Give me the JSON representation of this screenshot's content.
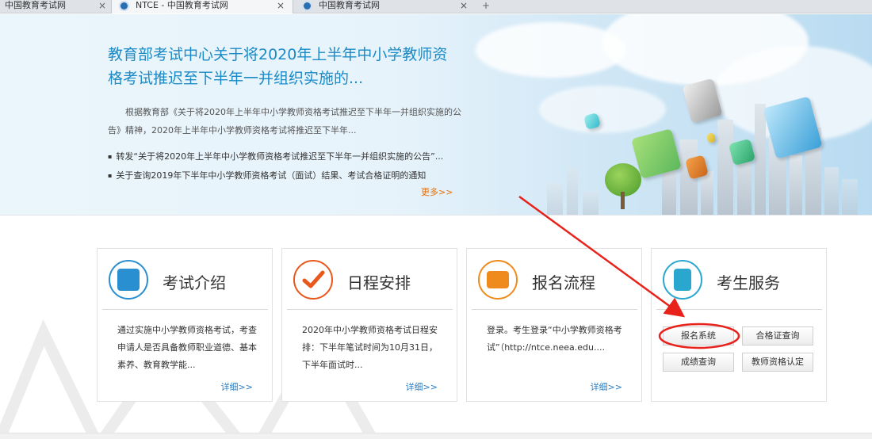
{
  "browser": {
    "tabs": [
      {
        "label": "中国教育考试网"
      },
      {
        "label": "NTCE - 中国教育考试网"
      },
      {
        "label": "中国教育考试网"
      }
    ]
  },
  "banner": {
    "title": "教育部考试中心关于将2020年上半年中小学教师资格考试推迟至下半年一并组织实施的...",
    "body": "根据教育部《关于将2020年上半年中小学教师资格考试推迟至下半年一并组织实施的公告》精神，2020年上半年中小学教师资格考试将推迟至下半年...",
    "list": [
      "转发“关于将2020年上半年中小学教师资格考试推迟至下半年一并组织实施的公告”...",
      "关于查询2019年下半年中小学教师资格考试（面试）结果、考试合格证明的通知"
    ],
    "more": "更多>>"
  },
  "cards": [
    {
      "title": "考试介绍",
      "desc": "通过实施中小学教师资格考试，考查申请人是否具备教师职业道德、基本素养、教育教学能...",
      "more": "详细>>"
    },
    {
      "title": "日程安排",
      "desc": "2020年中小学教师资格考试日程安排：下半年笔试时间为10月31日，下半年面试时...",
      "more": "详细>>"
    },
    {
      "title": "报名流程",
      "desc": "登录。考生登录“中小学教师资格考试”（http://ntce.neea.edu....",
      "more": "详细>>"
    },
    {
      "title": "考生服务",
      "buttons": [
        "报名系统",
        "合格证查询",
        "成绩查询",
        "教师资格认定"
      ]
    }
  ],
  "colors": {
    "accent_blue": "#1b8ac6",
    "accent_orange": "#e8700a",
    "annotation_red": "#e8221b"
  }
}
